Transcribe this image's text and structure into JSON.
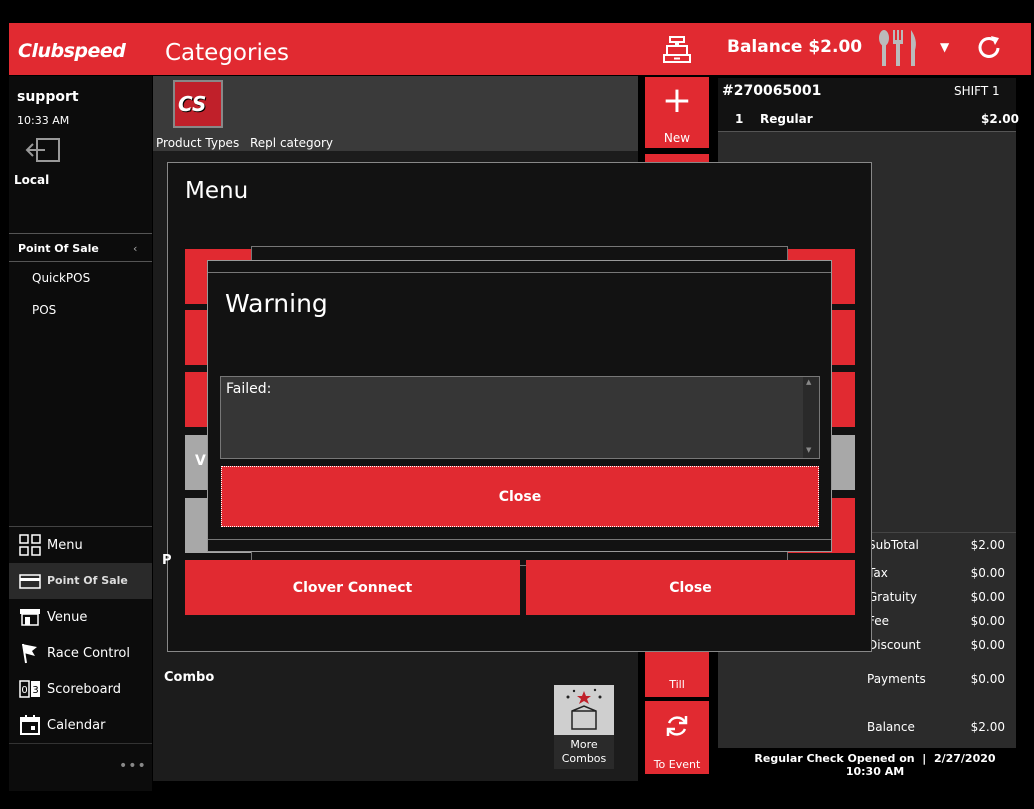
{
  "header": {
    "logo_text": "Clubspeed",
    "page_title": "Categories",
    "balance": "Balance $2.00",
    "colors": {
      "brand_red": "#e12a31",
      "background": "#000000"
    },
    "icons": [
      "cash-register-icon",
      "utensils-icon",
      "chevron-down-icon",
      "refresh-icon"
    ]
  },
  "sidebar": {
    "user": "support",
    "time": "10:33 AM",
    "location": "Local",
    "section": "Point Of Sale",
    "sub_items": [
      {
        "label": "QuickPOS"
      },
      {
        "label": "POS"
      }
    ],
    "bottom_items": [
      {
        "label": "Menu",
        "icon": "grid-icon"
      },
      {
        "label": "Point Of Sale",
        "icon": "card-icon"
      },
      {
        "label": "Venue",
        "icon": "store-icon"
      },
      {
        "label": "Race Control",
        "icon": "flag-icon"
      },
      {
        "label": "Scoreboard",
        "icon": "scoreboard-icon"
      },
      {
        "label": "Calendar",
        "icon": "calendar-icon"
      }
    ],
    "more": "•••"
  },
  "categories": {
    "logo_text": "CS",
    "tabs": [
      {
        "label": "Product Types"
      },
      {
        "label": "Repl category"
      }
    ],
    "combo_label": "Combo",
    "more_combos": "More\nCombos"
  },
  "actions": {
    "new_symbol": "+",
    "new_label": "New",
    "till_label": "Till",
    "event_label": "To Event"
  },
  "order": {
    "number": "#270065001",
    "shift": "SHIFT 1",
    "lines": [
      {
        "qty": "1",
        "name": "Regular",
        "price": "$2.00"
      }
    ],
    "totals": [
      {
        "label": "SubTotal",
        "value": "$2.00"
      },
      {
        "label": "Tax",
        "value": "$0.00"
      },
      {
        "label": "Gratuity",
        "value": "$0.00"
      },
      {
        "label": "Fee",
        "value": "$0.00"
      },
      {
        "label": "Discount",
        "value": "$0.00"
      },
      {
        "label": "Payments",
        "value": "$0.00"
      },
      {
        "label": "Balance",
        "value": "$2.00"
      }
    ],
    "check_info": "Regular Check Opened on  |  2/27/2020",
    "check_time": "10:30 AM"
  },
  "menu_dialog": {
    "title": "Menu",
    "partial_label": "V",
    "partial_label2": "P",
    "clover_button": "Clover Connect",
    "close_button": "Close"
  },
  "warning_dialog": {
    "title": "Warning",
    "message": "Failed:",
    "close_button": "Close"
  }
}
